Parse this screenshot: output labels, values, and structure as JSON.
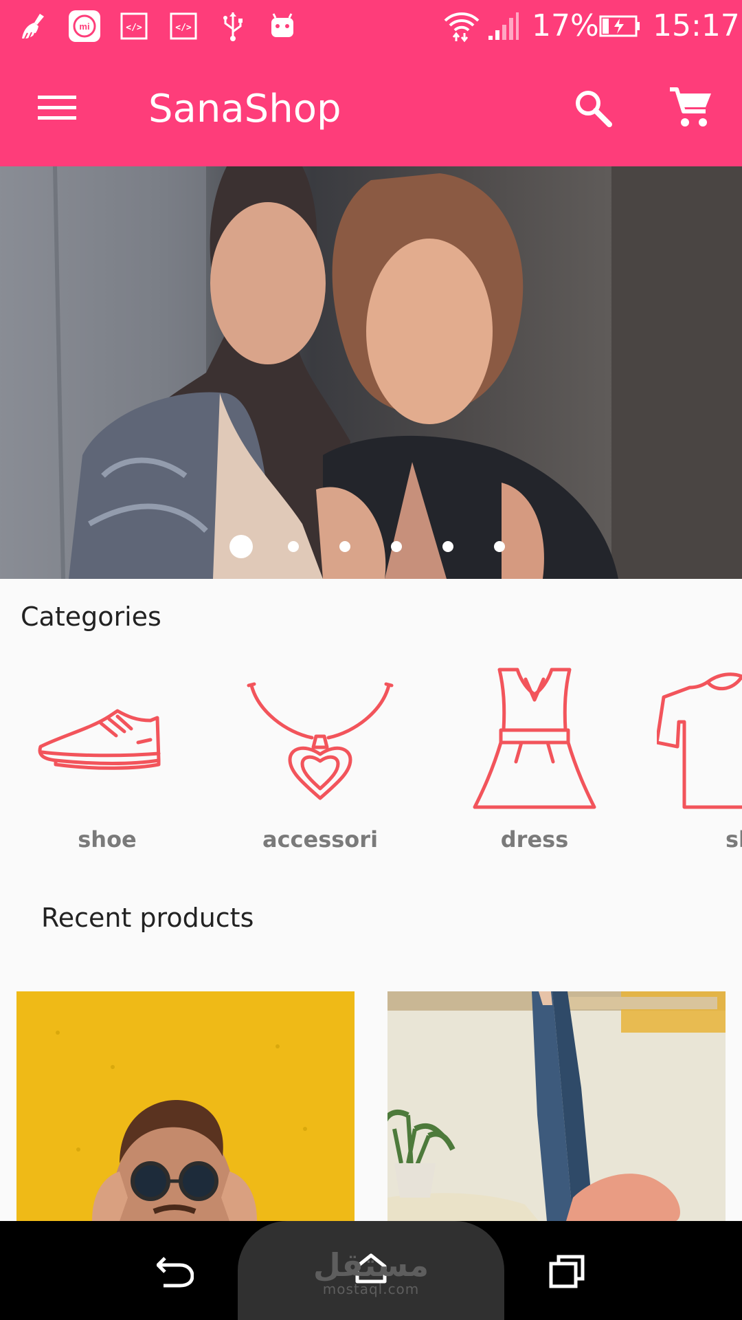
{
  "status_bar": {
    "battery_percent": "17%",
    "time": "15:17",
    "notification_icons": [
      "cleaner-icon",
      "mi-icon",
      "code-icon",
      "code-icon",
      "usb-icon",
      "android-icon"
    ],
    "system_icons": [
      "wifi-icon",
      "signal-icon",
      "battery-charging-icon"
    ]
  },
  "app_bar": {
    "title": "SanaShop",
    "menu_icon": "menu-icon",
    "search_icon": "search-icon",
    "cart_icon": "cart-icon"
  },
  "banner": {
    "slide_count": 6,
    "active_slide": 1
  },
  "categories": {
    "title": "Categories",
    "items": [
      {
        "label": "shoe",
        "icon": "shoe-icon"
      },
      {
        "label": "accessori",
        "icon": "necklace-icon"
      },
      {
        "label": "dress",
        "icon": "dress-icon"
      },
      {
        "label": "sh",
        "icon": "shirt-icon"
      }
    ]
  },
  "recent_products": {
    "title": "Recent products"
  },
  "nav_bar": {
    "watermark_ar": "مستقل",
    "watermark_en": "mostaql.com",
    "back_icon": "back-icon",
    "home_icon": "home-icon",
    "recents_icon": "recents-icon"
  },
  "colors": {
    "primary": "#fe3d7a",
    "icon_accent": "#f2545b",
    "category_label": "#7a7a7a",
    "background": "#fafafa"
  }
}
